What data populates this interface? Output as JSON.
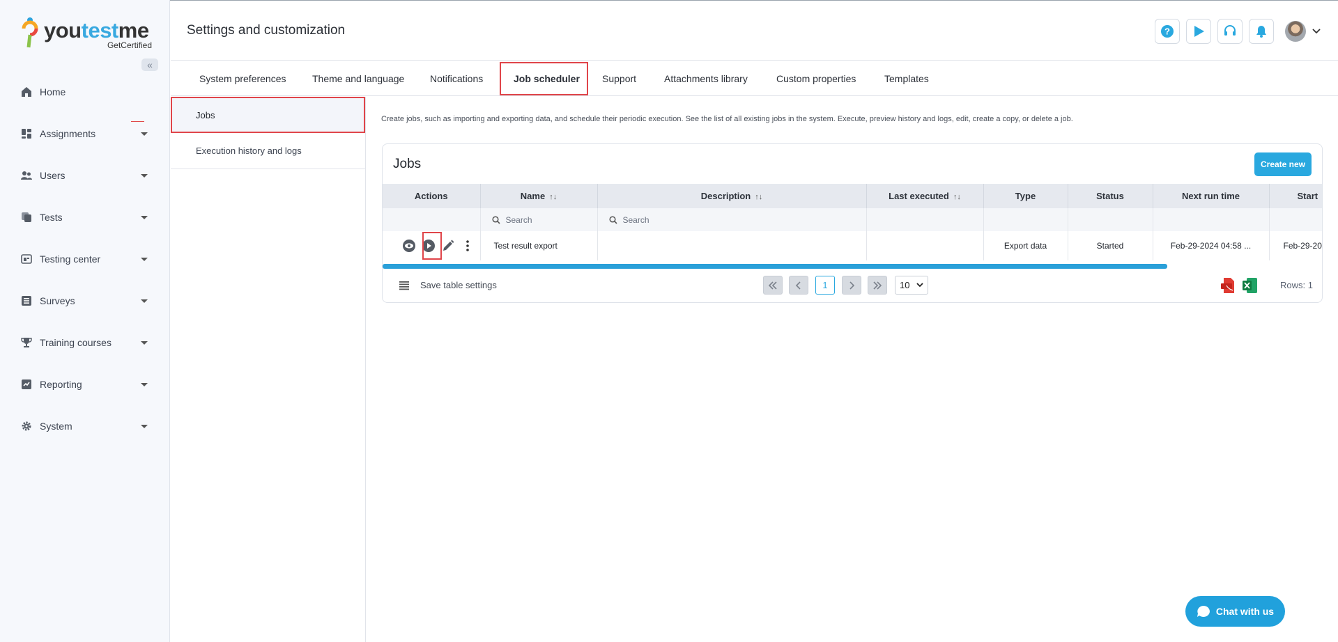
{
  "app": {
    "logo_text_you": "you",
    "logo_text_test": "test",
    "logo_text_me": "me",
    "logo_subtitle": "GetCertified",
    "collapse_label": "«"
  },
  "sidebar": {
    "items": [
      {
        "label": "Home",
        "icon": "home-icon"
      },
      {
        "label": "Assignments",
        "icon": "assignments-icon"
      },
      {
        "label": "Users",
        "icon": "users-icon"
      },
      {
        "label": "Tests",
        "icon": "tests-icon"
      },
      {
        "label": "Testing center",
        "icon": "testing-center-icon"
      },
      {
        "label": "Surveys",
        "icon": "surveys-icon"
      },
      {
        "label": "Training courses",
        "icon": "trophy-icon"
      },
      {
        "label": "Reporting",
        "icon": "reporting-icon"
      },
      {
        "label": "System",
        "icon": "gear-icon"
      }
    ]
  },
  "header": {
    "title": "Settings and customization",
    "buttons": [
      "help-icon",
      "play-icon",
      "headset-icon",
      "bell-icon"
    ]
  },
  "tabs": [
    {
      "label": "System preferences"
    },
    {
      "label": "Theme and language"
    },
    {
      "label": "Notifications"
    },
    {
      "label": "Job scheduler",
      "active": true
    },
    {
      "label": "Support"
    },
    {
      "label": "Attachments library"
    },
    {
      "label": "Custom properties"
    },
    {
      "label": "Templates"
    }
  ],
  "subnav": {
    "items": [
      {
        "label": "Jobs",
        "active": true
      },
      {
        "label": "Execution history and logs"
      }
    ]
  },
  "content": {
    "description": "Create jobs, such as importing and exporting data, and schedule their periodic execution. See the list of all existing jobs in the system. Execute, preview history and logs, edit, create a copy, or delete a job.",
    "card_title": "Jobs",
    "create_button": "Create new"
  },
  "table": {
    "columns": [
      "Actions",
      "Name",
      "Description",
      "Last executed",
      "Type",
      "Status",
      "Next run time",
      "Start"
    ],
    "search_placeholder": "Search",
    "rows": [
      {
        "name": "Test result export",
        "description": "",
        "last_executed": "",
        "type": "Export data",
        "status": "Started",
        "next_run_time": "Feb-29-2024 04:58 ...",
        "start": "Feb-29-20"
      }
    ]
  },
  "footer": {
    "save_settings": "Save table settings",
    "current_page": "1",
    "page_size": "10",
    "rows_label": "Rows: 1"
  },
  "chat": {
    "label": "Chat with us"
  },
  "colors": {
    "accent": "#29a8df",
    "highlight": "#e0454a",
    "sidebar_bg": "#f6f8fc"
  }
}
